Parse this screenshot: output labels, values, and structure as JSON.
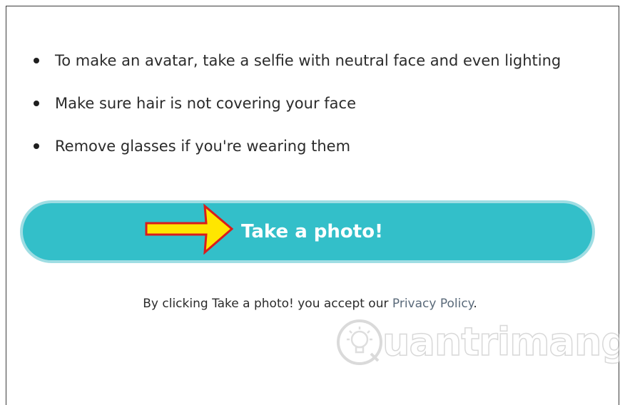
{
  "tips": [
    {
      "text": "To make an avatar, take a selfie with neutral face and even lighting"
    },
    {
      "text": "Make sure hair is not covering your face"
    },
    {
      "text": "Remove glasses if you're wearing them"
    }
  ],
  "action": {
    "label": "Take a photo!",
    "color": "#33bfc9"
  },
  "consent": {
    "prefix": "By clicking Take a photo! you accept our ",
    "link_text": "Privacy Policy",
    "suffix": "."
  },
  "annotation": {
    "icon": "arrow-right-icon",
    "fill_color": "#ffe600",
    "stroke_color": "#d91c1c"
  },
  "watermark": {
    "text": "uantrimang",
    "icon": "lightbulb-logo-icon"
  }
}
